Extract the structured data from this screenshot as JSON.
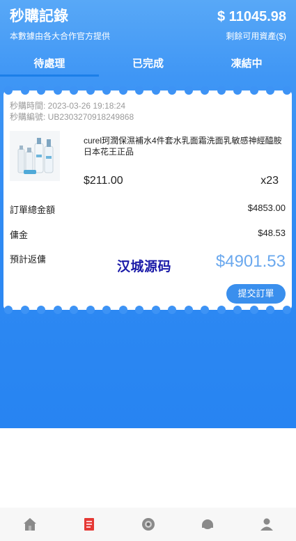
{
  "header": {
    "title": "秒購記錄",
    "balance": "$ 11045.98",
    "subtitle": "本數據由各大合作官方提供",
    "balance_label": "剩餘可用資產($)"
  },
  "tabs": [
    {
      "label": "待處理",
      "active": true
    },
    {
      "label": "已完成",
      "active": false
    },
    {
      "label": "凍結中",
      "active": false
    }
  ],
  "order": {
    "time": "秒購時間: 2023-03-26 19:18:24",
    "order_no": "秒購編號: UB2303270918249868",
    "product_name": "curel珂潤保濕補水4件套水乳面霜洗面乳敏感神經醯胺日本花王正品",
    "price": "$211.00",
    "qty": "x23",
    "total_label": "訂單總金額",
    "total_value": "$4853.00",
    "commission_label": "傭金",
    "commission_value": "$48.53",
    "expected_label": "預計返傭",
    "expected_value": "$4901.53",
    "watermark": "汉城源码",
    "submit_label": "提交訂單"
  },
  "colors": {
    "accent": "#3a8fed",
    "header_bg": "#2f8af3",
    "amount_highlight": "#6aa8ee",
    "watermark": "#1a1aa8"
  },
  "bottom_nav": [
    {
      "icon": "home-icon"
    },
    {
      "icon": "book-icon"
    },
    {
      "icon": "camera-icon"
    },
    {
      "icon": "service-icon"
    },
    {
      "icon": "user-icon"
    }
  ]
}
